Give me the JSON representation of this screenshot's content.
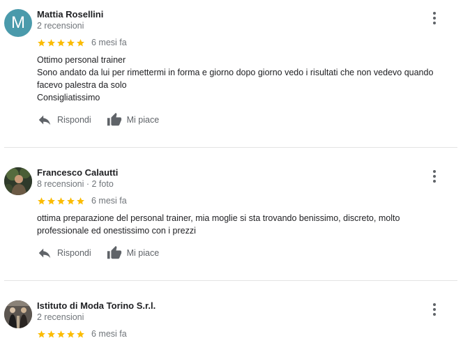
{
  "reviews": [
    {
      "avatar_letter": "M",
      "name": "Mattia Rosellini",
      "meta": "2 recensioni",
      "rating": 5,
      "date": "6 mesi fa",
      "text_lines": [
        "Ottimo personal trainer",
        "Sono andato da lui per rimettermi in forma e giorno dopo giorno vedo i risultati che non vedevo quando",
        "facevo palestra da solo",
        "Consigliatissimo"
      ],
      "reply_label": "Rispondi",
      "like_label": "Mi piace"
    },
    {
      "name": "Francesco Calautti",
      "meta": "8 recensioni · 2 foto",
      "rating": 5,
      "date": "6 mesi fa",
      "text_lines": [
        "ottima preparazione del personal trainer, mia moglie si sta trovando benissimo, discreto, molto",
        "professionale ed onestissimo con i prezzi"
      ],
      "reply_label": "Rispondi",
      "like_label": "Mi piace"
    },
    {
      "name": "Istituto di Moda Torino S.r.l.",
      "meta": "2 recensioni",
      "rating": 5,
      "date": "6 mesi fa"
    }
  ],
  "icons": {
    "menu": "more-vert-icon",
    "reply": "reply-arrow-icon",
    "like": "thumb-up-icon",
    "star": "star-icon"
  },
  "colors": {
    "star": "#fbbc04",
    "avatar_letter_bg": "#4a9aab",
    "secondary_text": "#70757a",
    "action_text": "#5f6368"
  }
}
